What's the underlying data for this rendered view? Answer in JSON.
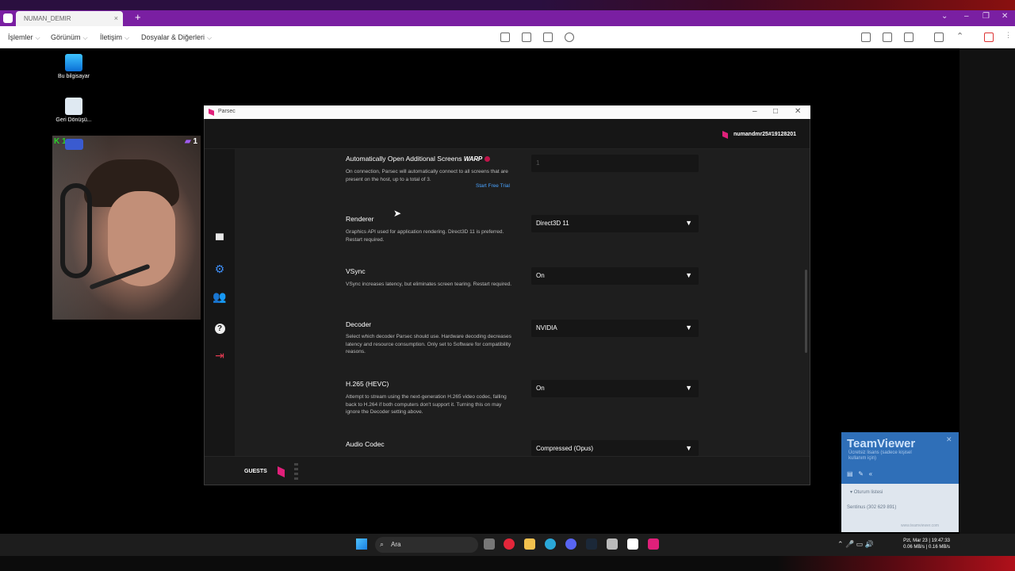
{
  "browser": {
    "tab_title": "NUMAN_DEMIR",
    "tab_close": "×",
    "new_tab": "+"
  },
  "menu": {
    "items": [
      "İşlemler",
      "Görünüm",
      "İletişim",
      "Dosyalar & Diğerleri"
    ],
    "chevron": "⌵"
  },
  "desktop": {
    "icons": [
      {
        "label": "Bu bilgisayar"
      },
      {
        "label": "Geri Dönüşü..."
      }
    ],
    "cam_badge_left": "1",
    "cam_badge_right": "1"
  },
  "parsec": {
    "window_title": "Parsec",
    "username": "numandmr25#19128201",
    "settings": [
      {
        "title": "Automatically Open Additional Screens",
        "badge": "WARP",
        "desc": "On connection, Parsec will automatically connect to all screens that are present on the host, up to a total of 3.",
        "value": "1",
        "link": "Start Free Trial"
      },
      {
        "title": "Renderer",
        "desc": "Graphics API used for application rendering. Direct3D 11 is preferred. Restart required.",
        "value": "Direct3D 11"
      },
      {
        "title": "VSync",
        "desc": "VSync increases latency, but eliminates screen tearing. Restart required.",
        "value": "On"
      },
      {
        "title": "Decoder",
        "desc": "Select which decoder Parsec should use. Hardware decoding decreases latency and resource consumption. Only set to Software for compatibility reasons.",
        "value": "NVIDIA"
      },
      {
        "title": "H.265 (HEVC)",
        "desc": "Attempt to stream using the next-generation H.265 video codec, falling back to H.264 if both computers don't support it. Turning this on may ignore the Decoder setting above.",
        "value": "On"
      },
      {
        "title": "Audio Codec",
        "value": "Compressed (Opus)"
      }
    ],
    "footer_label": "GUESTS"
  },
  "teamviewer": {
    "name": "TeamViewer",
    "subtitle": "Ücretsiz lisans (sadece kişisel kullanım için)",
    "session_list": "Oturum listesi",
    "session_entry": "Sentinus (302 629 891)",
    "website": "www.teamviewer.com"
  },
  "taskbar": {
    "search_placeholder": "Ara",
    "clock_line1": "Pzt, Mar 23 | 19:47:33",
    "clock_line2": "0.06 MB/s | 0.16 MB/s"
  },
  "colors": {
    "parsec_accent": "#e0207a",
    "tab_purple": "#7a1fa2",
    "link_blue": "#4aa3ff",
    "teamviewer_blue": "#2f6fb8"
  }
}
